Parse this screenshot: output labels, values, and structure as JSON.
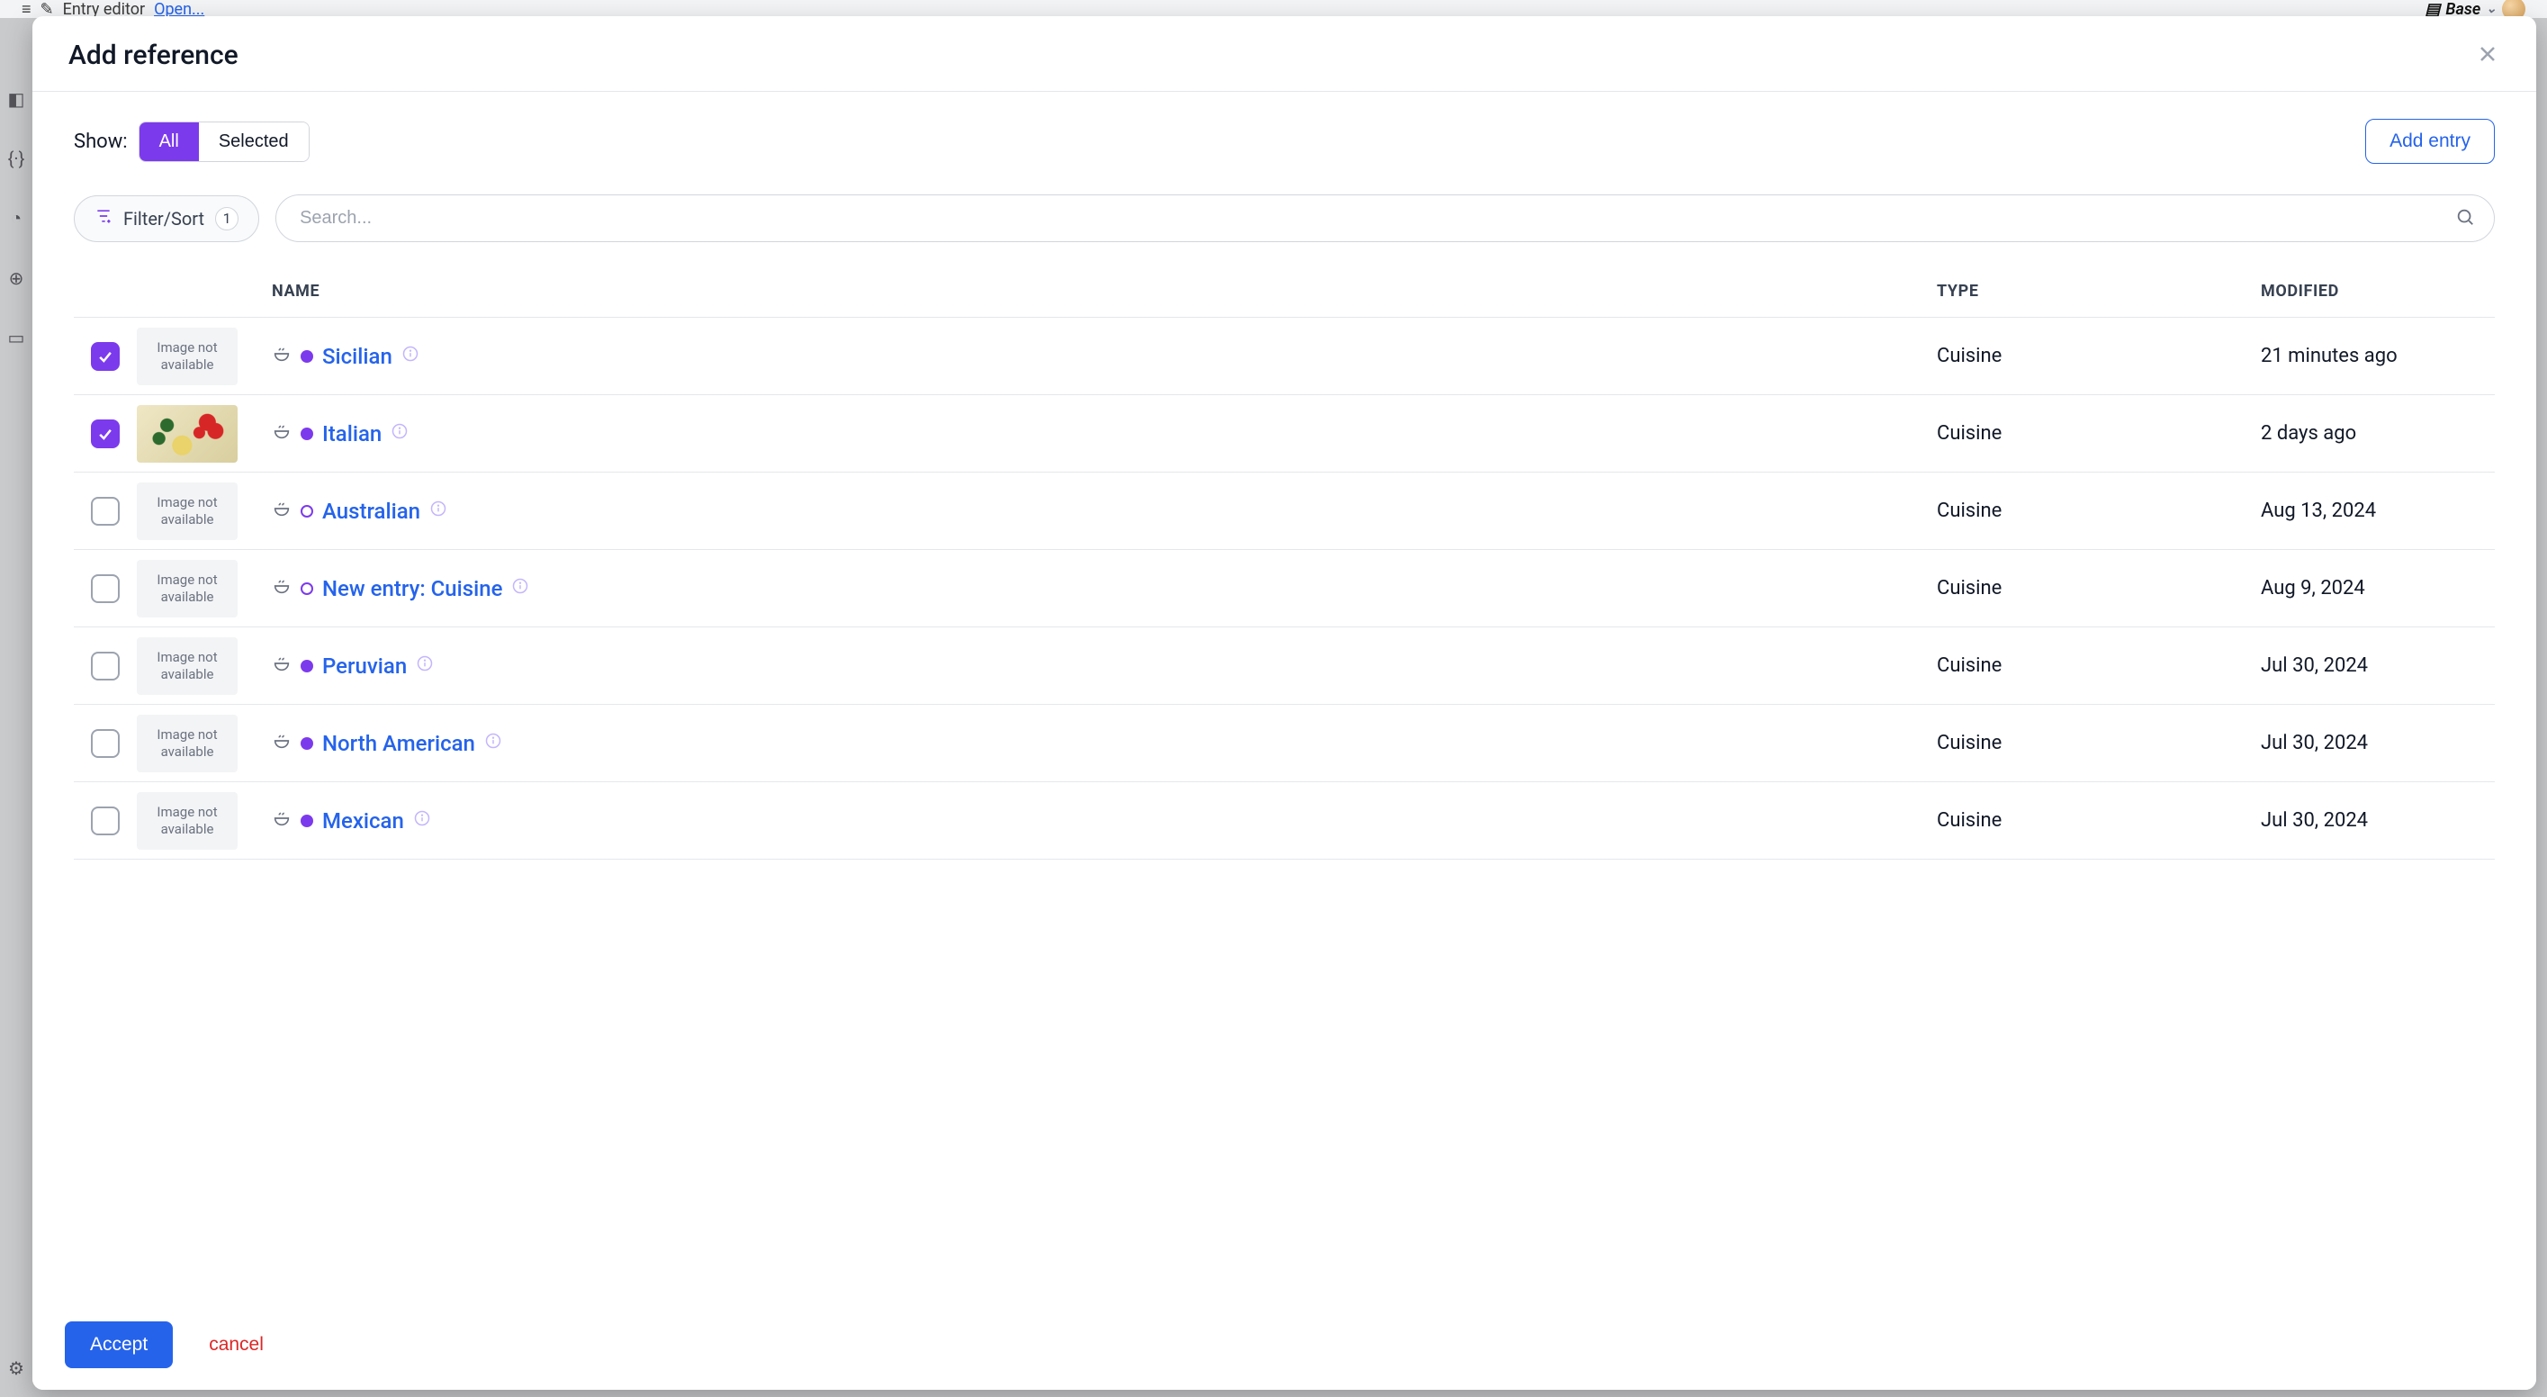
{
  "background": {
    "breadcrumb_icon": "pencil",
    "breadcrumb_text": "Entry editor",
    "breadcrumb_link": "Open...",
    "env_label": "Base"
  },
  "modal": {
    "title": "Add reference",
    "show_label": "Show:",
    "tab_all": "All",
    "tab_selected": "Selected",
    "add_entry": "Add entry",
    "filter_label": "Filter/Sort",
    "filter_count": "1",
    "search_placeholder": "Search...",
    "columns": {
      "name": "NAME",
      "type": "TYPE",
      "modified": "MODIFIED"
    },
    "noimg_text": "Image not available",
    "rows": [
      {
        "checked": true,
        "has_image": false,
        "status": "filled",
        "name": "Sicilian",
        "type": "Cuisine",
        "modified": "21 minutes ago"
      },
      {
        "checked": true,
        "has_image": true,
        "status": "filled",
        "name": "Italian",
        "type": "Cuisine",
        "modified": "2 days ago"
      },
      {
        "checked": false,
        "has_image": false,
        "status": "ring",
        "name": "Australian",
        "type": "Cuisine",
        "modified": "Aug 13, 2024"
      },
      {
        "checked": false,
        "has_image": false,
        "status": "ring",
        "name": "New entry: Cuisine",
        "type": "Cuisine",
        "modified": "Aug 9, 2024"
      },
      {
        "checked": false,
        "has_image": false,
        "status": "filled",
        "name": "Peruvian",
        "type": "Cuisine",
        "modified": "Jul 30, 2024"
      },
      {
        "checked": false,
        "has_image": false,
        "status": "filled",
        "name": "North American",
        "type": "Cuisine",
        "modified": "Jul 30, 2024"
      },
      {
        "checked": false,
        "has_image": false,
        "status": "filled",
        "name": "Mexican",
        "type": "Cuisine",
        "modified": "Jul 30, 2024"
      }
    ],
    "accept": "Accept",
    "cancel": "cancel"
  }
}
